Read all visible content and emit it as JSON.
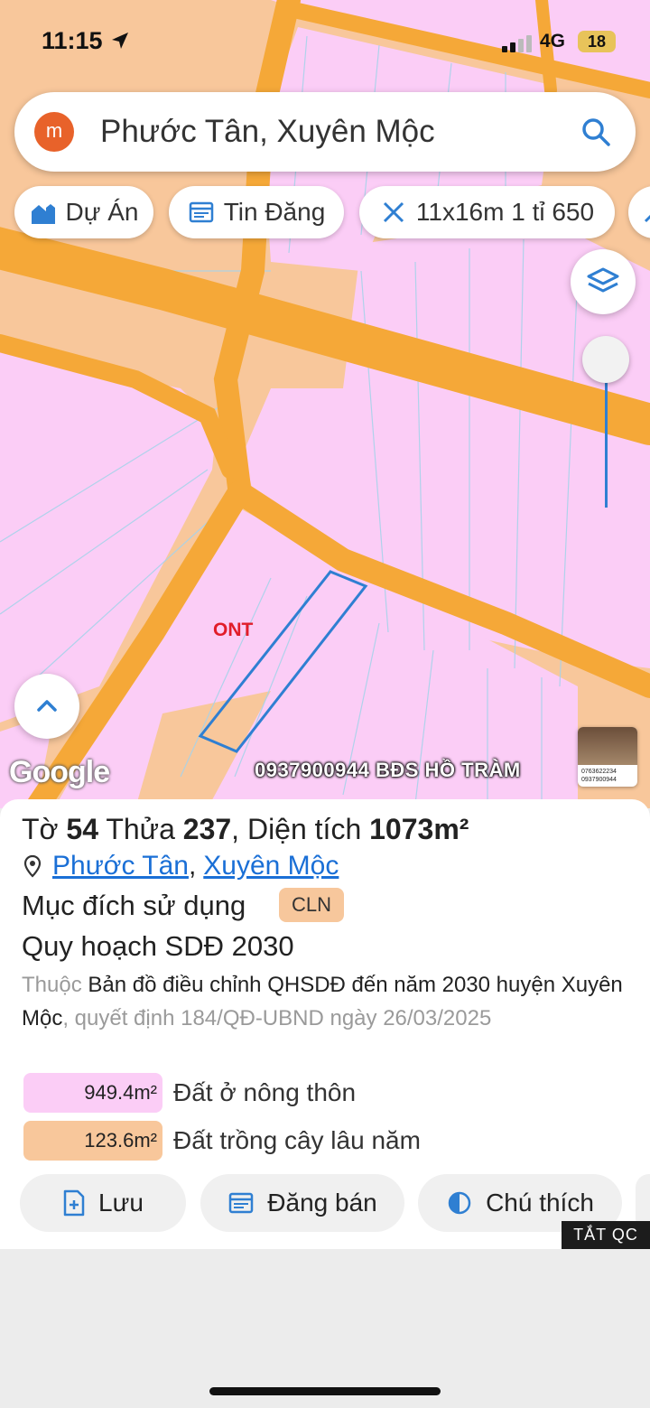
{
  "status_bar": {
    "time": "11:15",
    "network": "4G",
    "battery": "18"
  },
  "search": {
    "avatar_letter": "m",
    "query": "Phước Tân, Xuyên Mộc"
  },
  "filter_chips": [
    {
      "label": "Dự Án",
      "icon": "house-icon"
    },
    {
      "label": "Tin Đăng",
      "icon": "listing-icon"
    },
    {
      "label": "11x16m 1 tỉ 650",
      "icon": "ruler-icon"
    }
  ],
  "map": {
    "zone_label": "ONT",
    "attribution": "Google",
    "watermark": "0937900944 BĐS HỒ TRÀM",
    "thumbnail_phones": [
      "0763622234",
      "0937900944"
    ],
    "colors": {
      "residential": "#fbcdf6",
      "perennial": "#f8c79b",
      "road": "#f5a838",
      "parcel_outline": "#2f7fd2"
    }
  },
  "parcel": {
    "sheet_label": "Tờ",
    "sheet_number": "54",
    "plot_label": "Thửa",
    "plot_number": "237",
    "area_label": ", Diện tích",
    "area": "1073m²",
    "ward": "Phước Tân",
    "district": "Xuyên Mộc",
    "separator": ",",
    "purpose_label": "Mục đích sử dụng",
    "purpose_code": "CLN",
    "plan_title": "Quy hoạch SDĐ 2030",
    "desc_prefix": "Thuộc",
    "desc_main": "Bản đồ điều chỉnh QHSDĐ đến năm 2030 huyện Xuyên Mộc",
    "desc_suffix": ", quyết định 184/QĐ-UBND ngày 26/03/2025",
    "land_uses": [
      {
        "area": "949.4m²",
        "label": "Đất ở nông thôn",
        "color": "#fbcdf6"
      },
      {
        "area": "123.6m²",
        "label": "Đất trồng cây lâu năm",
        "color": "#f8c79b"
      }
    ]
  },
  "actions": [
    {
      "label": "Lưu",
      "icon": "save-icon"
    },
    {
      "label": "Đăng bán",
      "icon": "post-icon"
    },
    {
      "label": "Chú thích",
      "icon": "legend-icon"
    }
  ],
  "ad_toggle": "TẮT QC"
}
